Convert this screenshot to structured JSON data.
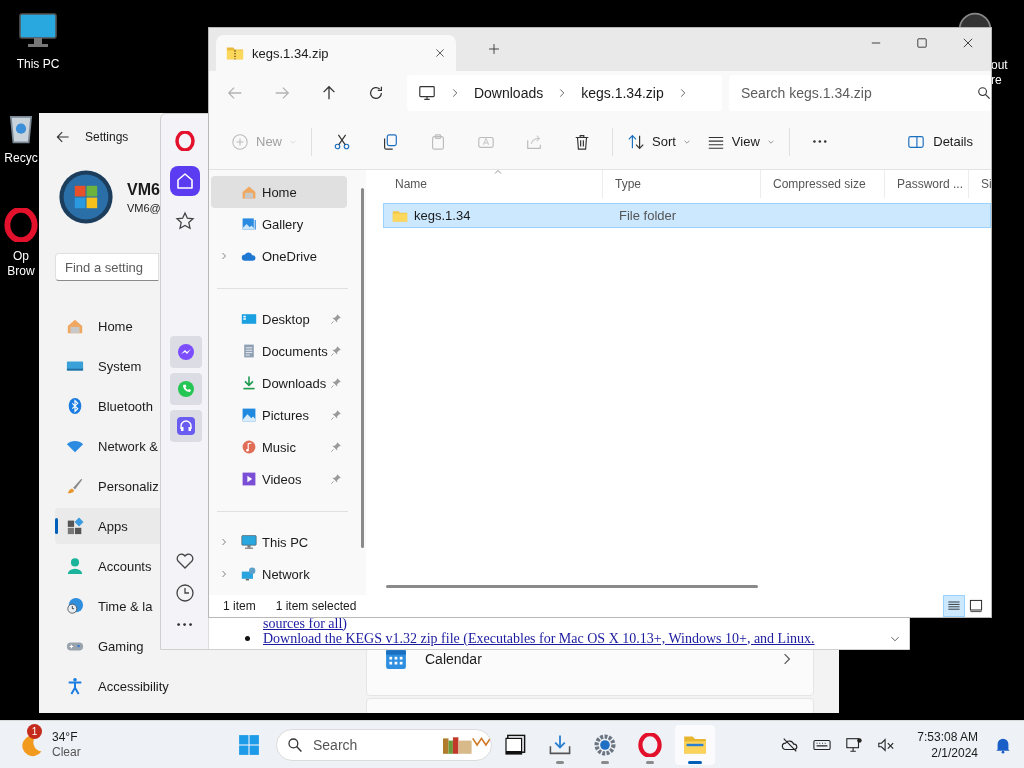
{
  "desktop_icons": [
    {
      "kind": "pc",
      "lines": [
        "This PC"
      ]
    },
    {
      "kind": "recycle-bin",
      "lines": [
        "Recyc"
      ]
    },
    {
      "kind": "opera",
      "lines": [
        "Op",
        "Brow"
      ]
    }
  ],
  "right_edge_texts": [
    "out",
    "re"
  ],
  "settings": {
    "title": "Settings",
    "user_name": "VM6",
    "user_email": "VM6@",
    "search": {
      "placeholder": "Find a setting"
    },
    "nav": [
      {
        "kind": "home",
        "label": "Home",
        "selected": false
      },
      {
        "kind": "system",
        "label": "System",
        "selected": false
      },
      {
        "kind": "bluetooth",
        "label": "Bluetooth",
        "selected": false
      },
      {
        "kind": "network",
        "label": "Network &",
        "selected": false
      },
      {
        "kind": "personalization",
        "label": "Personaliz",
        "selected": false
      },
      {
        "kind": "apps",
        "label": "Apps",
        "selected": true
      },
      {
        "kind": "accounts",
        "label": "Accounts",
        "selected": false
      },
      {
        "kind": "time",
        "label": "Time & la",
        "selected": false
      },
      {
        "kind": "gaming",
        "label": "Gaming",
        "selected": false
      },
      {
        "kind": "accessibility",
        "label": "Accessibility",
        "selected": false
      }
    ],
    "cards": [
      {
        "kind": "calendar",
        "label": "Calendar"
      }
    ]
  },
  "browser": {
    "sidebar_top": [
      {
        "kind": "opera",
        "selected": false
      },
      {
        "kind": "home",
        "selected": true
      },
      {
        "kind": "star",
        "selected": false
      }
    ],
    "sidebar_apps": [
      {
        "kind": "messenger"
      },
      {
        "kind": "whatsapp"
      },
      {
        "kind": "music"
      }
    ],
    "sidebar_bottom": [
      {
        "kind": "heart"
      },
      {
        "kind": "history"
      },
      {
        "kind": "more"
      }
    ],
    "page_lines": [
      {
        "text": "sources for all)",
        "bullet": false
      },
      {
        "text": "Download the KEGS v1.32 zip file (Executables for Mac OS X 10.13+, Windows 10+, and Linux.",
        "bullet": true
      }
    ]
  },
  "explorer": {
    "tab_title": "kegs.1.34.zip",
    "nav_buttons": [
      {
        "kind": "back",
        "disabled": true
      },
      {
        "kind": "forward",
        "disabled": true
      },
      {
        "kind": "up",
        "disabled": false
      },
      {
        "kind": "refresh",
        "disabled": false
      }
    ],
    "breadcrumbs": [
      "Downloads",
      "kegs.1.34.zip"
    ],
    "search": {
      "placeholder": "Search kegs.1.34.zip"
    },
    "toolbar": [
      {
        "kind": "new",
        "label": "New",
        "disabled": true
      },
      {
        "kind": "cut",
        "disabled": false
      },
      {
        "kind": "copy",
        "disabled": false
      },
      {
        "kind": "paste",
        "disabled": true
      },
      {
        "kind": "rename",
        "disabled": true
      },
      {
        "kind": "share",
        "disabled": true
      },
      {
        "kind": "delete",
        "disabled": false
      },
      {
        "kind": "sort",
        "label": "Sort",
        "disabled": false
      },
      {
        "kind": "view",
        "label": "View",
        "disabled": false
      },
      {
        "kind": "more",
        "disabled": false
      }
    ],
    "details_label": "Details",
    "nav_sections": [
      [
        {
          "kind": "home",
          "label": "Home",
          "selected": true,
          "expandable": false,
          "pinned": false
        },
        {
          "kind": "gallery",
          "label": "Gallery",
          "selected": false,
          "expandable": false,
          "pinned": false
        },
        {
          "kind": "cloud",
          "label": "OneDrive",
          "selected": false,
          "expandable": true,
          "pinned": false
        }
      ],
      [
        {
          "kind": "desktop",
          "label": "Desktop",
          "selected": false,
          "expandable": false,
          "pinned": true
        },
        {
          "kind": "documents",
          "label": "Documents",
          "selected": false,
          "expandable": false,
          "pinned": true
        },
        {
          "kind": "downloads",
          "label": "Downloads",
          "selected": false,
          "expandable": false,
          "pinned": true
        },
        {
          "kind": "pictures",
          "label": "Pictures",
          "selected": false,
          "expandable": false,
          "pinned": true
        },
        {
          "kind": "music",
          "label": "Music",
          "selected": false,
          "expandable": false,
          "pinned": true
        },
        {
          "kind": "videos",
          "label": "Videos",
          "selected": false,
          "expandable": false,
          "pinned": true
        }
      ],
      [
        {
          "kind": "pc",
          "label": "This PC",
          "selected": false,
          "expandable": true,
          "pinned": false
        },
        {
          "kind": "network",
          "label": "Network",
          "selected": false,
          "expandable": true,
          "pinned": false
        }
      ]
    ],
    "columns": [
      "Name",
      "Type",
      "Compressed size",
      "Password ...",
      "Si"
    ],
    "rows": [
      {
        "name": "kegs.1.34",
        "type": "File folder",
        "selected": true
      }
    ],
    "status": {
      "count": "1 item",
      "selection": "1 item selected"
    },
    "view_modes": [
      {
        "kind": "details",
        "selected": true
      },
      {
        "kind": "tiles",
        "selected": false
      }
    ]
  },
  "taskbar": {
    "weather": {
      "badge": "1",
      "temperature": "34°F",
      "condition": "Clear"
    },
    "search": {
      "placeholder": "Search"
    },
    "apps": [
      {
        "kind": "task-view",
        "running": false,
        "active": false
      },
      {
        "kind": "downloads",
        "running": true,
        "active": false
      },
      {
        "kind": "settings",
        "running": true,
        "active": false
      },
      {
        "kind": "opera",
        "running": true,
        "active": false
      },
      {
        "kind": "explorer",
        "running": true,
        "active": true
      }
    ],
    "tray": [
      {
        "kind": "cloud-off"
      },
      {
        "kind": "keyboard"
      },
      {
        "kind": "network"
      },
      {
        "kind": "mute"
      }
    ],
    "time": "7:53:08 AM",
    "date": "2/1/2024"
  }
}
